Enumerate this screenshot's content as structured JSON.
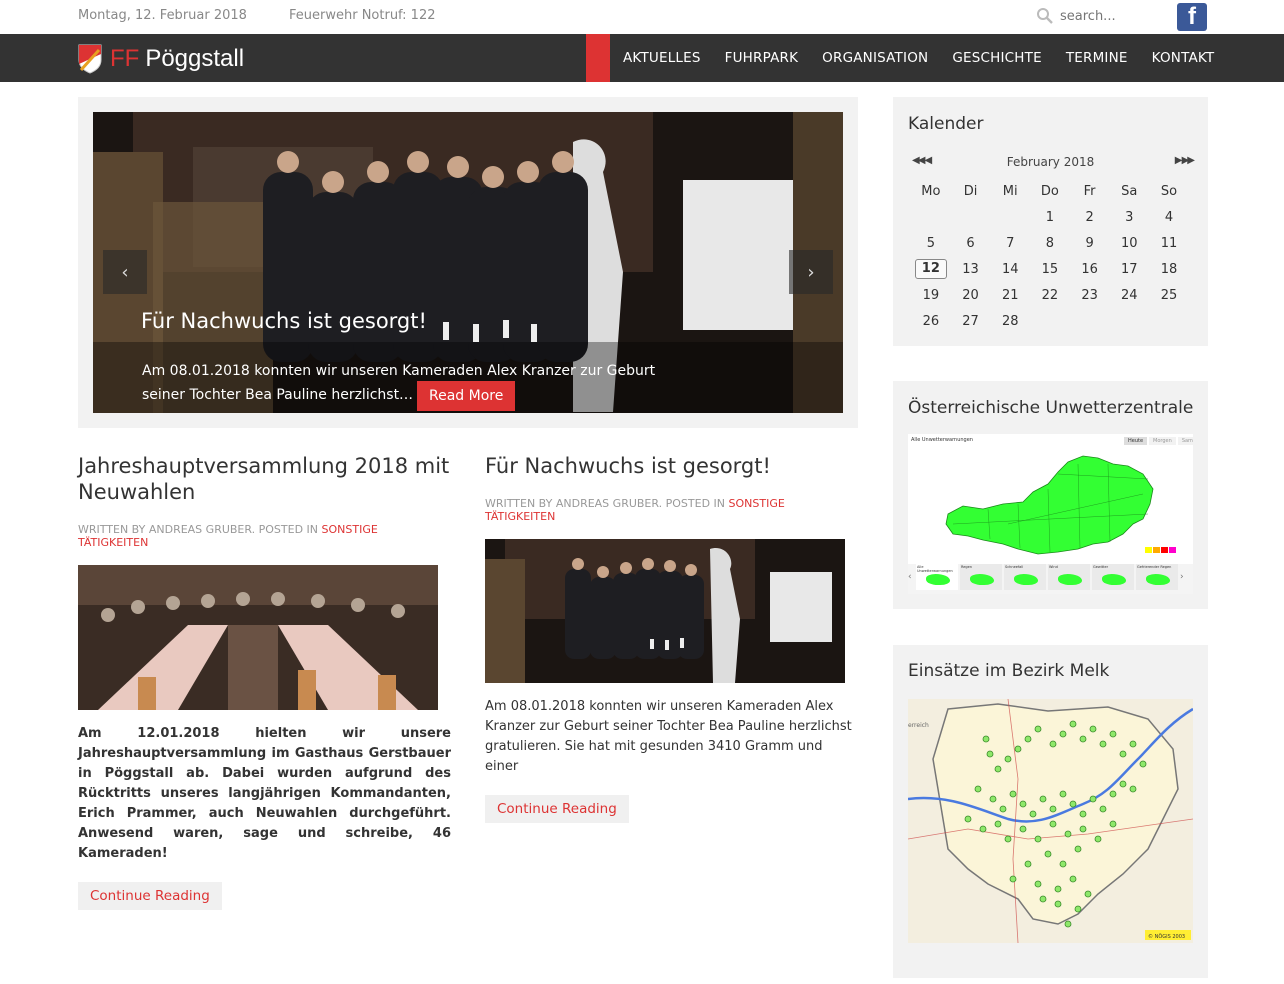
{
  "topbar": {
    "date": "Montag, 12. Februar 2018",
    "notruf": "Feuerwehr Notruf: 122",
    "search_placeholder": "search...",
    "facebook_label": "f"
  },
  "header": {
    "logo_ff": "FF",
    "logo_name": "Pöggstall",
    "menu": [
      "AKTUELLES",
      "FUHRPARK",
      "ORGANISATION",
      "GESCHICHTE",
      "TERMINE",
      "KONTAKT"
    ]
  },
  "slider": {
    "title": "Für Nachwuchs ist gesorgt!",
    "text": "Am 08.01.2018 konnten wir unseren Kameraden Alex Kranzer zur Geburt seiner Tochter Bea Pauline herzlichst…",
    "read_more": "Read More",
    "prev_label": "‹",
    "next_label": "›"
  },
  "articles": [
    {
      "title": "Jahreshauptversammlung 2018 mit Neuwahlen",
      "meta_prefix": "WRITTEN BY ANDREAS GRUBER. POSTED IN ",
      "category": "SONSTIGE TÄTIGKEITEN",
      "excerpt": "Am 12.01.2018 hielten wir unsere Jahreshauptversammlung im Gasthaus Gerstbauer in Pöggstall ab. Dabei wurden aufgrund des Rücktritts unseres langjährigen Kommandanten, Erich Prammer, auch Neuwahlen durchgeführt. Anwesend waren, sage und schreibe, 46 Kameraden!",
      "continue": "Continue Reading"
    },
    {
      "title": "Für Nachwuchs ist gesorgt!",
      "meta_prefix": "WRITTEN BY ANDREAS GRUBER. POSTED IN ",
      "category": "SONSTIGE TÄTIGKEITEN",
      "excerpt": "Am 08.01.2018 konnten wir unseren Kameraden Alex Kranzer zur Geburt seiner Tochter Bea Pauline herzlichst gratulieren. Sie hat mit gesunden 3410 Gramm und einer",
      "continue": "Continue Reading"
    }
  ],
  "calendar": {
    "title": "Kalender",
    "month": "February 2018",
    "prev": "◀◀ ◀",
    "next": "▶ ▶▶",
    "weekdays": [
      "Mo",
      "Di",
      "Mi",
      "Do",
      "Fr",
      "Sa",
      "So"
    ],
    "weeks": [
      [
        "",
        "",
        "",
        "1",
        "2",
        "3",
        "4"
      ],
      [
        "5",
        "6",
        "7",
        "8",
        "9",
        "10",
        "11"
      ],
      [
        "12",
        "13",
        "14",
        "15",
        "16",
        "17",
        "18"
      ],
      [
        "19",
        "20",
        "21",
        "22",
        "23",
        "24",
        "25"
      ],
      [
        "26",
        "27",
        "28",
        "",
        "",
        "",
        ""
      ]
    ],
    "today": "12"
  },
  "weather": {
    "title": "Österreichische Unwetterzentrale",
    "map_title": "Alle Unwetterwarnungen",
    "tabs": [
      "Heute",
      "Morgen",
      "Samstag"
    ],
    "thumbs": [
      "Alle Unwetterwarnungen",
      "Regen",
      "Schneefall",
      "Wind",
      "Gewitter",
      "Gefrierender Regen"
    ]
  },
  "einsaetze": {
    "title": "Einsätze im Bezirk Melk",
    "copyright": "© NÖGIS 2003",
    "edge_label": "erreich"
  },
  "colors": {
    "accent": "#dd3333",
    "navbar": "#333333",
    "map_green": "#33ff33"
  }
}
